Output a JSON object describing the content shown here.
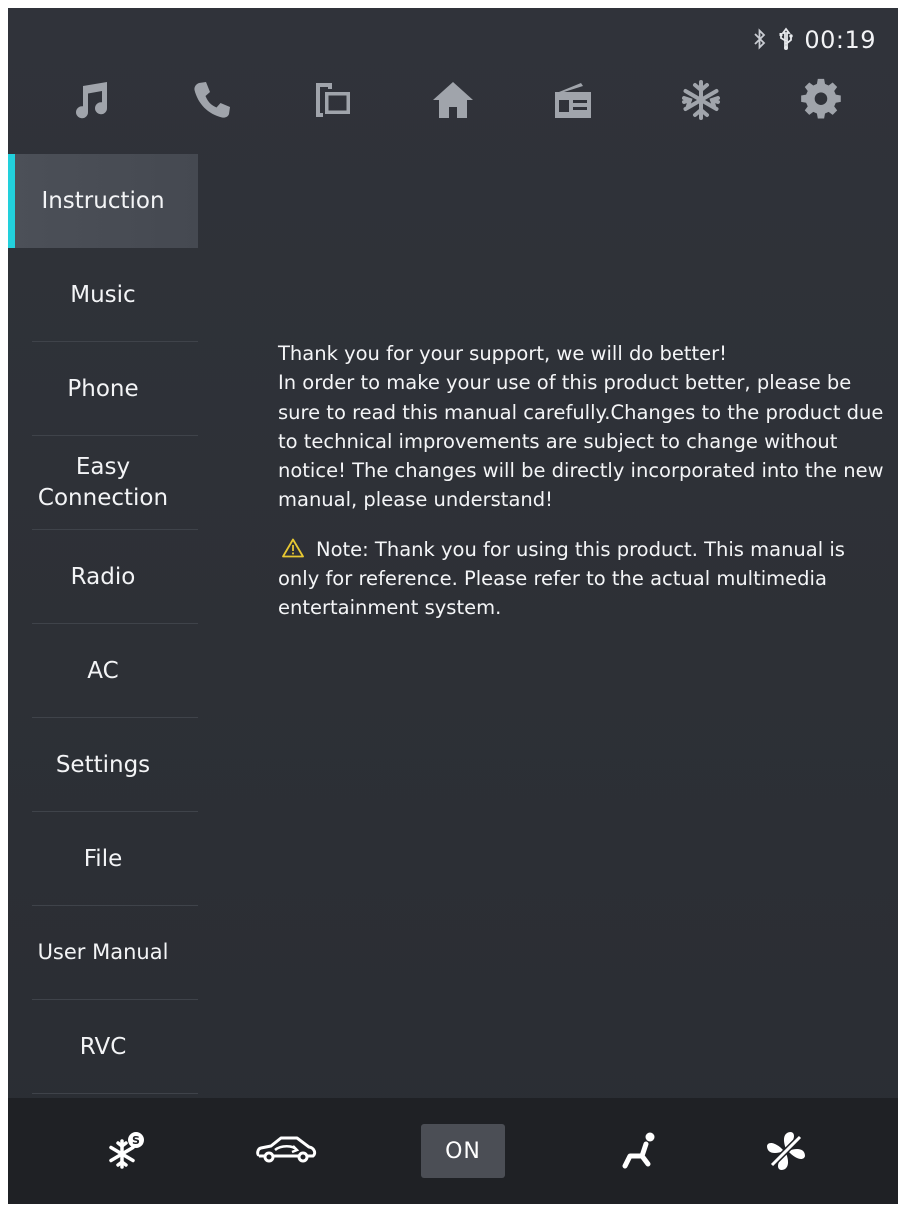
{
  "status": {
    "bluetooth_icon": "bluetooth-icon",
    "usb_icon": "usb-icon",
    "time": "00:19"
  },
  "topnav": {
    "icons": [
      "music-icon",
      "phone-icon",
      "easy-connection-icon",
      "home-icon",
      "radio-icon",
      "ac-snowflake-icon",
      "settings-gear-icon"
    ]
  },
  "sidebar": {
    "items": [
      {
        "label": "Instruction",
        "active": true
      },
      {
        "label": "Music"
      },
      {
        "label": "Phone"
      },
      {
        "label": "Easy\nConnection"
      },
      {
        "label": "Radio"
      },
      {
        "label": "AC"
      },
      {
        "label": "Settings"
      },
      {
        "label": "File"
      },
      {
        "label": "User Manual"
      },
      {
        "label": "RVC"
      }
    ]
  },
  "content": {
    "paragraph1": "Thank you for your support, we will do better!\nIn order to make your use of this product better, please be sure to read this manual carefully.Changes to the product due to technical improvements are subject to change without notice! The changes will be directly incorporated into the new manual, please understand!",
    "note_icon": "warning-icon",
    "note": "Note: Thank you for using this product. This manual is only for reference. Please refer to the actual multimedia entertainment system."
  },
  "bottombar": {
    "icons": [
      "ac-snowflake-s-icon",
      "car-recirculation-icon",
      "seat-airflow-icon",
      "fan-icon"
    ],
    "on_label": "ON"
  },
  "colors": {
    "accent": "#22d0dc",
    "background": "#2d3036",
    "bottombar": "#1f2125",
    "warning": "#e8c832"
  }
}
